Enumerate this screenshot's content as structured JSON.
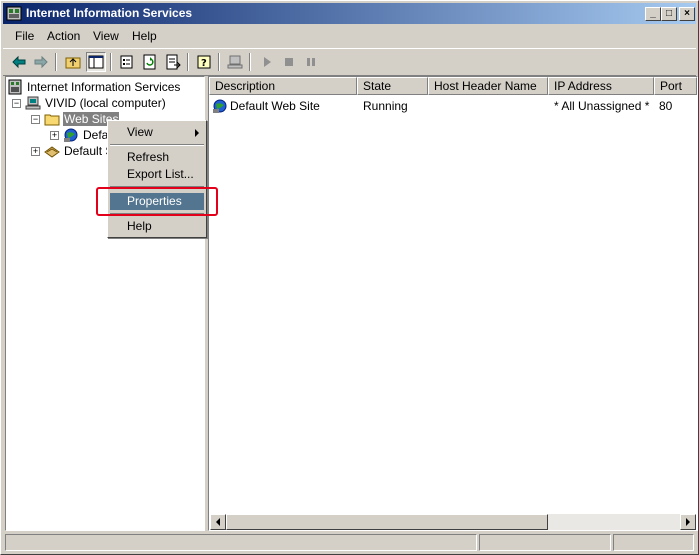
{
  "window": {
    "title": "Internet Information Services",
    "controls": {
      "minimize": "_",
      "maximize": "□",
      "close": "×"
    }
  },
  "menubar": {
    "items": [
      "File",
      "Action",
      "View",
      "Help"
    ]
  },
  "toolbar": {
    "icons": [
      "back-icon",
      "forward-icon",
      "up-folder-icon",
      "show-hide-tree-icon",
      "properties-icon",
      "refresh-icon",
      "export-list-icon",
      "help-icon",
      "computer-icon",
      "play-icon",
      "stop-icon",
      "pause-icon"
    ]
  },
  "tree": {
    "root": "Internet Information Services",
    "computer": "VIVID (local computer)",
    "web_sites": "Web Sites",
    "default_web_site": "Defa",
    "default_smtp": "Default S"
  },
  "list": {
    "columns": [
      "Description",
      "State",
      "Host Header Name",
      "IP Address",
      "Port"
    ],
    "rows": [
      {
        "description": "Default Web Site",
        "state": "Running",
        "host_header": "",
        "ip_address": "* All Unassigned *",
        "port": "80"
      }
    ]
  },
  "context_menu": {
    "items": [
      "View",
      "Refresh",
      "Export List...",
      "Properties",
      "Help"
    ],
    "highlighted": "Properties"
  },
  "colors": {
    "title_start": "#0a246a",
    "title_end": "#a6caf0",
    "menu_highlight": "#53758f",
    "annotation_box": "#e3001b"
  }
}
